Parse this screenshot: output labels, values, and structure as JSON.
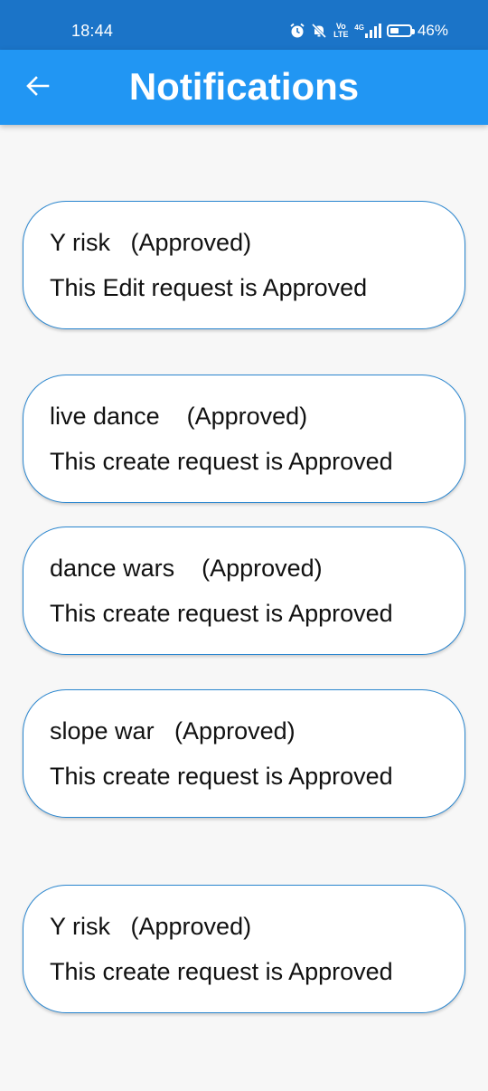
{
  "status_bar": {
    "time": "18:44",
    "battery_text": "46%",
    "battery_level": 0.46,
    "network_label": "4G",
    "volte_label": "Vo LTE",
    "icons": [
      "alarm-icon",
      "mute-icon",
      "volte-icon",
      "signal-icon",
      "battery-icon"
    ]
  },
  "app_bar": {
    "title": "Notifications",
    "back_icon": "back-arrow-icon",
    "color": "#2196f3"
  },
  "notifications": [
    {
      "title": "Y risk   (Approved)",
      "message": "This Edit request is Approved"
    },
    {
      "title": "live dance    (Approved)",
      "message": "This create request is Approved"
    },
    {
      "title": "dance wars    (Approved)",
      "message": "This create request is Approved"
    },
    {
      "title": "slope war   (Approved)",
      "message": "This create request is Approved"
    },
    {
      "title": "Y risk   (Approved)",
      "message": "This create request is Approved"
    }
  ]
}
